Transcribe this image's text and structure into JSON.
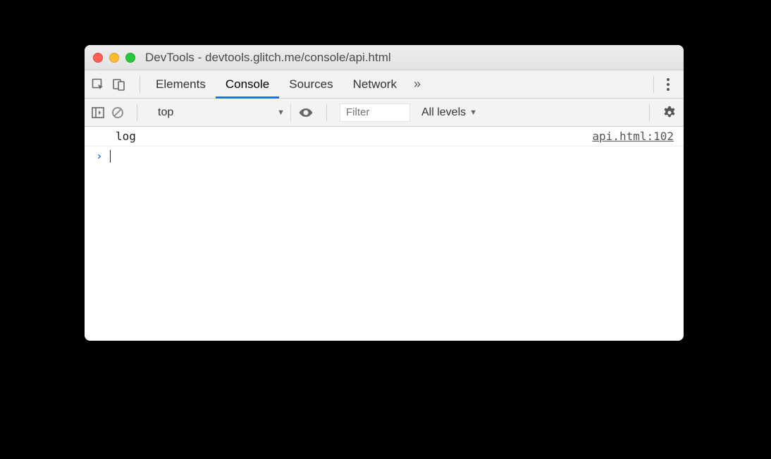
{
  "window": {
    "title": "DevTools - devtools.glitch.me/console/api.html"
  },
  "tabs": {
    "elements": "Elements",
    "console": "Console",
    "sources": "Sources",
    "network": "Network"
  },
  "filter": {
    "context": "top",
    "placeholder": "Filter",
    "levels": "All levels"
  },
  "console": {
    "entry0": {
      "msg": "log",
      "src": "api.html:102"
    },
    "prompt": "›"
  }
}
